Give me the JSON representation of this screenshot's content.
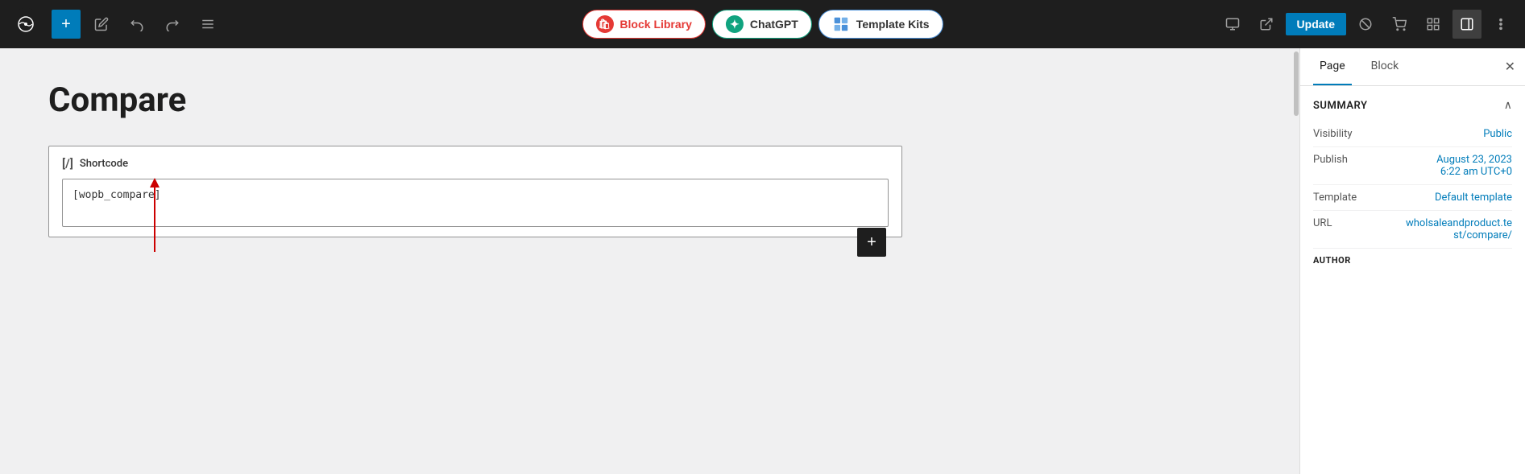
{
  "toolbar": {
    "add_label": "+",
    "block_library_label": "Block Library",
    "chatgpt_label": "ChatGPT",
    "template_kits_label": "Template Kits",
    "update_label": "Update",
    "icons": {
      "pen": "✏",
      "undo": "↩",
      "redo": "↪",
      "list": "≡",
      "preview": "□",
      "external": "⬜",
      "prohibit": "⊘",
      "cart": "🛒",
      "grid": "⊞",
      "sidebar": "▣",
      "more": "⋮"
    }
  },
  "editor": {
    "page_title": "Compare",
    "shortcode_block": {
      "header_icon": "[/]",
      "header_label": "Shortcode",
      "content": "[wopb_compare]"
    }
  },
  "sidebar": {
    "tab_page": "Page",
    "tab_block": "Block",
    "close_icon": "✕",
    "summary_label": "Summary",
    "visibility_label": "Visibility",
    "visibility_value": "Public",
    "publish_label": "Publish",
    "publish_value": "August 23, 2023\n6:22 am UTC+0",
    "publish_line1": "August 23, 2023",
    "publish_line2": "6:22 am UTC+0",
    "template_label": "Template",
    "template_value": "Default template",
    "url_label": "URL",
    "url_value": "wholsaleandproduct.te\nst/compare/",
    "url_line1": "wholsaleandproduct.te",
    "url_line2": "st/compare/",
    "author_label": "AUTHOR"
  }
}
